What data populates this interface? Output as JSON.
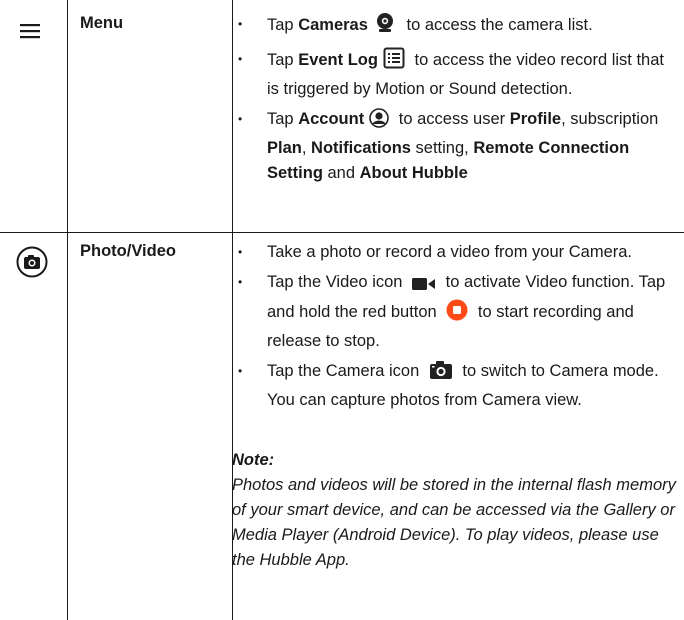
{
  "rows": [
    {
      "label": "Menu",
      "icon": "hamburger-menu-icon",
      "bullets": [
        {
          "parts": [
            {
              "t": "Tap ",
              "b": false
            },
            {
              "t": "Cameras",
              "b": true
            },
            {
              "icon": "camera-list-icon"
            },
            {
              "t": " to access the camera list.",
              "b": false
            }
          ]
        },
        {
          "parts": [
            {
              "t": "Tap ",
              "b": false
            },
            {
              "t": "Event Log",
              "b": true
            },
            {
              "icon": "event-log-icon"
            },
            {
              "t": " to access the video record list that is triggered by Motion or Sound detection.",
              "b": false
            }
          ]
        },
        {
          "parts": [
            {
              "t": "Tap ",
              "b": false
            },
            {
              "t": "Account",
              "b": true
            },
            {
              "icon": "account-icon"
            },
            {
              "t": " to access user ",
              "b": false
            },
            {
              "t": "Profile",
              "b": true
            },
            {
              "t": ", subscription ",
              "b": false
            },
            {
              "t": "Plan",
              "b": true
            },
            {
              "t": ", ",
              "b": false
            },
            {
              "t": "Notifications",
              "b": true
            },
            {
              "t": " setting, ",
              "b": false
            },
            {
              "t": "Remote Connection Setting",
              "b": true
            },
            {
              "t": " and ",
              "b": false
            },
            {
              "t": "About Hubble",
              "b": true
            }
          ]
        }
      ]
    },
    {
      "label": "Photo/Video",
      "icon": "camera-circle-icon",
      "bullets": [
        {
          "parts": [
            {
              "t": "Take a photo or record a video from your Camera.",
              "b": false
            }
          ]
        },
        {
          "parts": [
            {
              "t": "Tap the Video icon ",
              "b": false
            },
            {
              "icon": "video-icon"
            },
            {
              "t": " to activate Video function. Tap and hold the red button ",
              "b": false
            },
            {
              "icon": "record-button-icon"
            },
            {
              "t": " to start recording and release to stop.",
              "b": false
            }
          ]
        },
        {
          "parts": [
            {
              "t": "Tap the Camera icon ",
              "b": false
            },
            {
              "icon": "camera-icon"
            },
            {
              "t": " to switch to Camera mode. You can capture photos from Camera view.",
              "b": false
            }
          ]
        }
      ],
      "note_title": "Note:",
      "note_text": "Photos and videos will be stored in the internal flash memory of your smart device, and can be accessed via the Gallery or Media Player (Android Device). To play videos, please use the Hubble App."
    }
  ],
  "colors": {
    "text": "#1a1a1a",
    "record": "#ff4a17",
    "icon_dark": "#222222"
  }
}
